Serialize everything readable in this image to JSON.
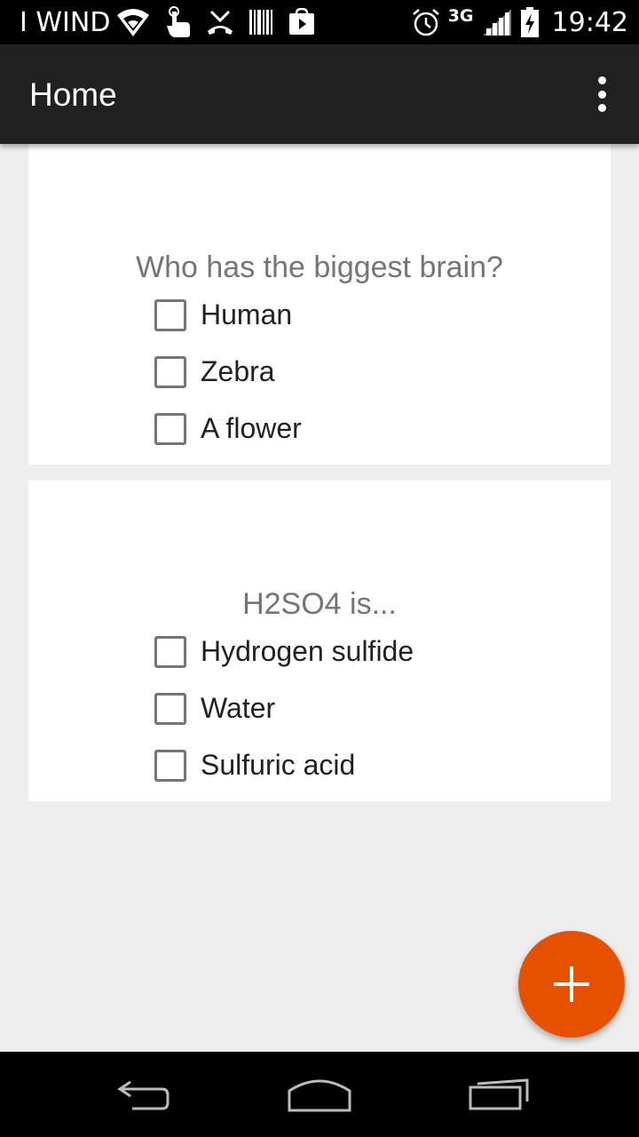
{
  "status_bar": {
    "carrier": "I WIND",
    "network_type": "3G",
    "time": "19:42",
    "icons": [
      "wifi-icon",
      "touch-icon",
      "missed-call-icon",
      "barcode-icon",
      "play-store-icon",
      "alarm-icon",
      "signal-icon",
      "battery-charging-icon"
    ]
  },
  "app_bar": {
    "title": "Home",
    "overflow_icon": "more-vert-icon"
  },
  "questions": [
    {
      "text": "Who has the biggest brain?",
      "options": [
        "Human",
        "Zebra",
        "A flower"
      ]
    },
    {
      "text": "H2SO4 is...",
      "options": [
        "Hydrogen sulfide",
        "Water",
        "Sulfuric acid"
      ]
    }
  ],
  "fab": {
    "icon": "plus-icon",
    "color": "#E65100"
  },
  "nav_bar": {
    "icons": [
      "back-icon",
      "home-icon",
      "recents-icon"
    ]
  },
  "colors": {
    "app_bar": "#212121",
    "background": "#EEEEEE",
    "accent": "#E65100",
    "question_text": "#757575"
  }
}
